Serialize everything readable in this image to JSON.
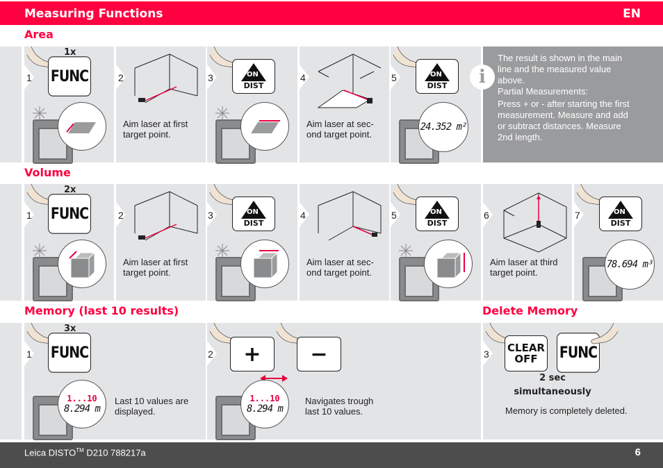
{
  "header": {
    "title": "Measuring Functions",
    "language": "EN"
  },
  "sections": {
    "area": {
      "title": "Area",
      "press_count": "1x",
      "steps": [
        {
          "num": "1",
          "key": "FUNC"
        },
        {
          "num": "2",
          "caption_lines": [
            "Aim laser at first",
            "target point."
          ]
        },
        {
          "num": "3",
          "key_top": "ON",
          "key_bottom": "DIST"
        },
        {
          "num": "4",
          "caption_lines": [
            "Aim laser at sec-",
            "ond target point."
          ]
        },
        {
          "num": "5",
          "key_top": "ON",
          "key_bottom": "DIST",
          "result": "24.352 m²"
        }
      ],
      "info": {
        "icon": "info-icon",
        "lines": [
          "The result is shown in the main",
          "line and the measured value",
          "above.",
          "Partial Measurements:",
          "Press + or - after starting the first",
          "measurement. Measure and add",
          "or subtract distances. Measure",
          "2nd length."
        ]
      }
    },
    "volume": {
      "title": "Volume",
      "press_count": "2x",
      "steps": [
        {
          "num": "1",
          "key": "FUNC"
        },
        {
          "num": "2",
          "caption_lines": [
            "Aim laser at first",
            "target point."
          ]
        },
        {
          "num": "3",
          "key_top": "ON",
          "key_bottom": "DIST"
        },
        {
          "num": "4",
          "caption_lines": [
            "Aim laser at sec-",
            "ond target point."
          ]
        },
        {
          "num": "5",
          "key_top": "ON",
          "key_bottom": "DIST"
        },
        {
          "num": "6",
          "caption_lines": [
            "Aim laser at third",
            "target point."
          ]
        },
        {
          "num": "7",
          "key_top": "ON",
          "key_bottom": "DIST",
          "result": "78.694 m³"
        }
      ]
    },
    "memory": {
      "title": "Memory (last 10 results)",
      "press_count": "3x",
      "steps": [
        {
          "num": "1",
          "key": "FUNC",
          "range": "1...10",
          "value": "8.294 m",
          "caption_lines": [
            "Last 10 values are",
            "displayed."
          ]
        },
        {
          "num": "2",
          "plus": "+",
          "minus": "−",
          "range": "1...10",
          "value": "8.294 m",
          "caption_lines": [
            "Navigates trough",
            "last 10 values."
          ]
        }
      ]
    },
    "delete": {
      "title": "Delete Memory",
      "step": {
        "num": "3",
        "key1_top": "CLEAR",
        "key1_bottom": "OFF",
        "key2": "FUNC",
        "duration": "2 sec",
        "mode": "simultaneously",
        "caption": "Memory is completely deleted."
      }
    }
  },
  "footer": {
    "product": "Leica DISTO",
    "tm": "TM",
    "model": " D210 788217a",
    "page": "6"
  },
  "colors": {
    "accent": "#ff0040",
    "panel": "#e3e4e6",
    "info_panel": "#9a9b9d",
    "footer": "#4d4d4d"
  }
}
